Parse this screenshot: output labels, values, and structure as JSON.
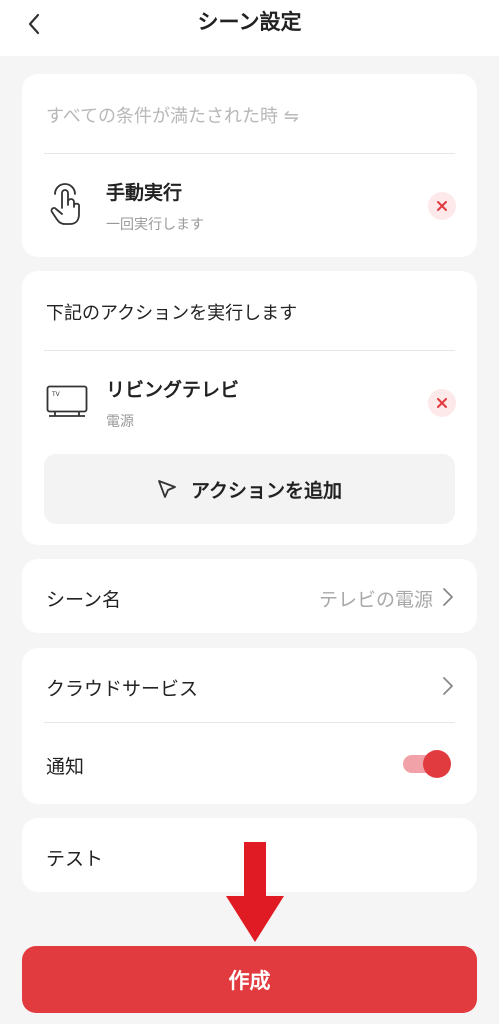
{
  "header": {
    "title": "シーン設定",
    "back_icon": "chevron-left-icon"
  },
  "conditions": {
    "title": "すべての条件が満たされた時 ⇋",
    "item": {
      "title": "手動実行",
      "subtitle": "一回実行します",
      "icon": "hand-tap-icon"
    }
  },
  "actions": {
    "title": "下記のアクションを実行します",
    "item": {
      "title": "リビングテレビ",
      "subtitle": "電源",
      "icon": "tv-icon"
    },
    "add_label": "アクションを追加"
  },
  "scene_name": {
    "label": "シーン名",
    "value": "テレビの電源"
  },
  "cloud_service": {
    "label": "クラウドサービス"
  },
  "notification": {
    "label": "通知",
    "enabled": true
  },
  "test": {
    "label": "テスト"
  },
  "create_button": {
    "label": "作成"
  },
  "colors": {
    "accent": "#e23b3f",
    "background": "#f5f5f5",
    "card": "#ffffff",
    "arrow": "#e01b24"
  }
}
